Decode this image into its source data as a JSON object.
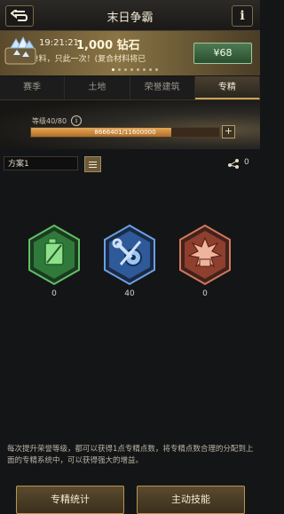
{
  "header": {
    "title": "末日争霸",
    "back_icon": "return-arrow-icon",
    "info_label": "i"
  },
  "banner": {
    "time": "19:21:21",
    "amount": "1,000 钻石",
    "description": "!料，只此一次！(复合材料将已",
    "price": "¥68",
    "pages": 8,
    "active_page": 0
  },
  "tabs": [
    {
      "label": "赛季",
      "active": false
    },
    {
      "label": "土地",
      "active": false
    },
    {
      "label": "荣誉建筑",
      "active": false
    },
    {
      "label": "专精",
      "active": true
    }
  ],
  "level": {
    "label": "等级40/80",
    "progress_text": "8666401/11600000",
    "current": 8666401,
    "max": 11600000
  },
  "plan": {
    "name": "方案1",
    "shared_count": "0"
  },
  "branches": [
    {
      "name": "green-fuel-branch",
      "icon": "fuel-can-icon",
      "count": "0",
      "color": "#3e9a4a"
    },
    {
      "name": "blue-gear-branch",
      "icon": "wrench-gear-icon",
      "count": "40",
      "color": "#3b6fb8"
    },
    {
      "name": "red-explosion-branch",
      "icon": "explosion-icon",
      "count": "0",
      "color": "#b8553e"
    }
  ],
  "description": "每次提升荣誉等级，都可以获得1点专精点数，将专精点数合理的分配到上面的专精系统中，可以获得强大的增益。",
  "buttons": {
    "stats": "专精统计",
    "skills": "主动技能"
  },
  "colors": {
    "accent": "#c9a45a",
    "progress": "#d48f42",
    "price_button": "#3c6a42"
  }
}
